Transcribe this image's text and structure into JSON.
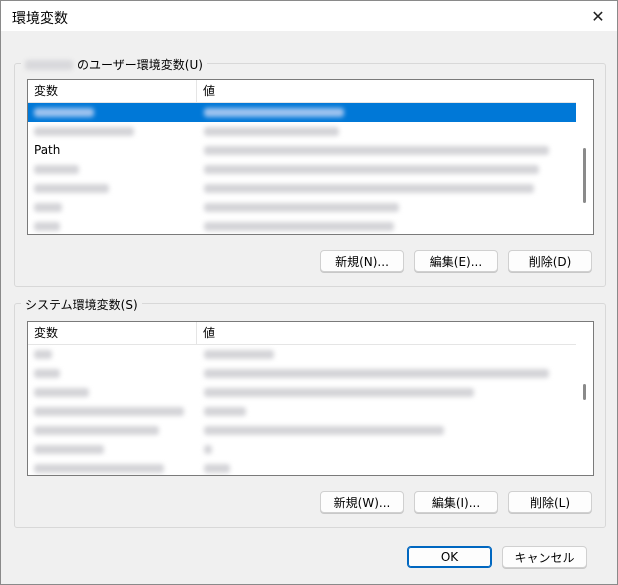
{
  "window": {
    "title": "環境変数"
  },
  "user_group": {
    "legend_suffix": "のユーザー環境変数(U)",
    "columns": [
      "変数",
      "値"
    ],
    "rows": [
      {
        "var": "",
        "var_w": 60,
        "val_w": 140,
        "selected": true
      },
      {
        "var": "",
        "var_w": 100,
        "val_w": 135,
        "selected": false
      },
      {
        "var": "Path",
        "var_w": 0,
        "val_w": 345,
        "selected": false
      },
      {
        "var": "",
        "var_w": 45,
        "val_w": 335,
        "selected": false
      },
      {
        "var": "",
        "var_w": 75,
        "val_w": 330,
        "selected": false
      },
      {
        "var": "",
        "var_w": 28,
        "val_w": 195,
        "selected": false
      },
      {
        "var": "",
        "var_w": 26,
        "val_w": 190,
        "selected": false
      }
    ],
    "buttons": {
      "new": "新規(N)...",
      "edit": "編集(E)...",
      "delete": "削除(D)"
    }
  },
  "system_group": {
    "legend": "システム環境変数(S)",
    "columns": [
      "変数",
      "値"
    ],
    "rows": [
      {
        "var": "",
        "var_w": 18,
        "val_w": 70,
        "selected": false
      },
      {
        "var": "",
        "var_w": 26,
        "val_w": 345,
        "selected": false
      },
      {
        "var": "",
        "var_w": 55,
        "val_w": 270,
        "selected": false
      },
      {
        "var": "",
        "var_w": 150,
        "val_w": 42,
        "selected": false
      },
      {
        "var": "",
        "var_w": 125,
        "val_w": 240,
        "selected": false
      },
      {
        "var": "",
        "var_w": 70,
        "val_w": 8,
        "selected": false
      },
      {
        "var": "",
        "var_w": 130,
        "val_w": 26,
        "selected": false
      }
    ],
    "buttons": {
      "new": "新規(W)...",
      "edit": "編集(I)...",
      "delete": "削除(L)"
    }
  },
  "footer": {
    "ok": "OK",
    "cancel": "キャンセル"
  }
}
